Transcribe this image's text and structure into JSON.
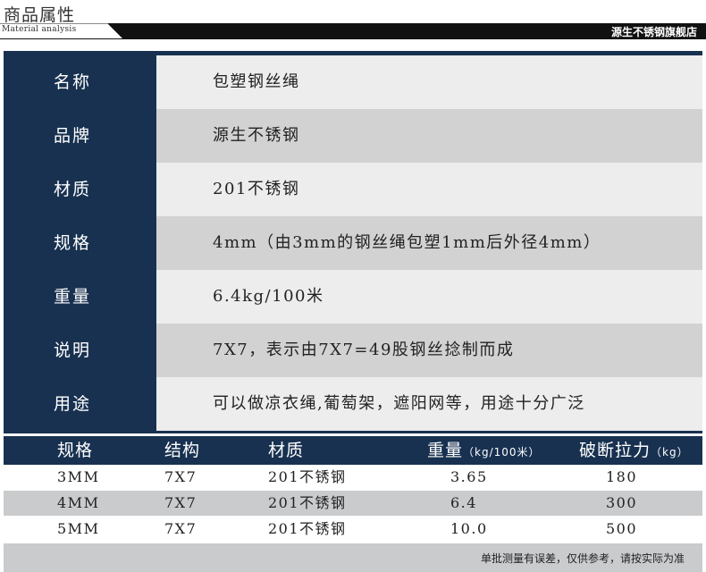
{
  "header": {
    "title": "商品属性",
    "subtitle": "Material analysis",
    "shop": "源生不锈钢旗舰店"
  },
  "attributes": [
    {
      "label": "名称",
      "value": "包塑钢丝绳"
    },
    {
      "label": "品牌",
      "value": "源生不锈钢"
    },
    {
      "label": "材质",
      "value": "201不锈钢"
    },
    {
      "label": "规格",
      "value": "4mm（由3mm的钢丝绳包塑1mm后外径4mm）"
    },
    {
      "label": "重量",
      "value": " 6.4kg/100米"
    },
    {
      "label": "说明",
      "value": "7X7，表示由7X7=49股钢丝捻制而成"
    },
    {
      "label": "用途",
      "value": "可以做凉衣绳,葡萄架，遮阳网等，用途十分广泛"
    }
  ],
  "spec_table": {
    "headers": {
      "spec": "规格",
      "structure": "结构",
      "material": "材质",
      "weight": "重量",
      "weight_unit": "（kg/100米）",
      "strength": "破断拉力",
      "strength_unit": "（kg）"
    },
    "rows": [
      {
        "spec": "3MM",
        "structure": "7X7",
        "material": "201不锈钢",
        "weight": "3.65",
        "strength": "180"
      },
      {
        "spec": "4MM",
        "structure": "7X7",
        "material": "201不锈钢",
        "weight": "6.4",
        "strength": "300"
      },
      {
        "spec": "5MM",
        "structure": "7X7",
        "material": "201不锈钢",
        "weight": "10.0",
        "strength": "500"
      }
    ],
    "note": "单批测量有误差，仅供参考，请按实际为准"
  },
  "colors": {
    "navy": "#183150",
    "header_black": "#111111",
    "row_light": "#ededed",
    "row_dark": "#d2d2d2",
    "row_shade": "#c9cbcc"
  }
}
